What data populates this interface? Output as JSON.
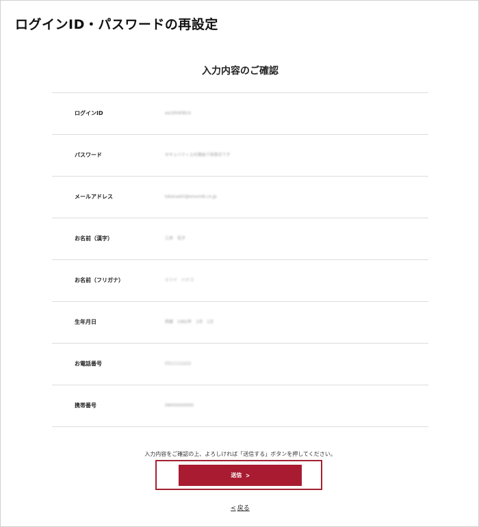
{
  "page": {
    "title": "ログインID・パスワードの再設定"
  },
  "confirm": {
    "heading": "入力内容のご確認",
    "rows": [
      {
        "label": "ログインID",
        "value": "ea19040814"
      },
      {
        "label": "パスワード",
        "value": "セキュリティ上の理由で非表示です"
      },
      {
        "label": "メールアドレス",
        "value": "takanashi@erounds.co.jp"
      },
      {
        "label": "お名前（漢字）",
        "value": "三井　花子"
      },
      {
        "label": "お名前（フリガナ）",
        "value": "ミツイ　ハナコ"
      },
      {
        "label": "生年月日",
        "value": "西暦　1992年　1月　1日"
      },
      {
        "label": "お電話番号",
        "value": "0311112222"
      },
      {
        "label": "携帯番号",
        "value": "09000000000"
      }
    ]
  },
  "footer": {
    "notice": "入力内容をご確認の上、よろしければ「送信する」ボタンを押してください。",
    "submit_label": "送信",
    "submit_icon": "chevron-right-icon",
    "back_label": "戻る",
    "back_icon": "chevron-left-icon"
  },
  "colors": {
    "accent": "#a81b30",
    "highlight_border": "#a32030",
    "divider": "#dcdcdc"
  }
}
